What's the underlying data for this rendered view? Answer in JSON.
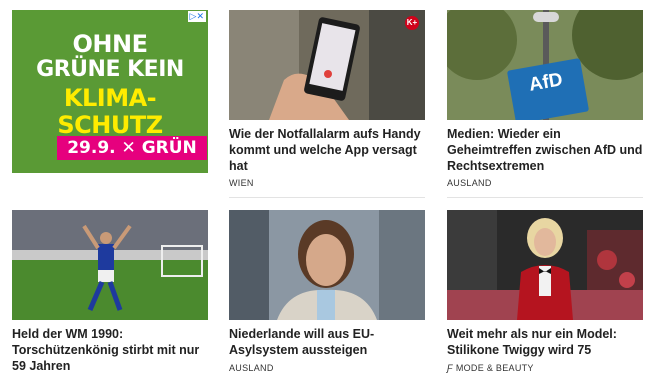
{
  "ad": {
    "lines": [
      "OHNE",
      "GRÜNE KEIN",
      "KLIMA-",
      "SCHUTZ"
    ],
    "badge": "29.9. ✕ GRÜN",
    "choice_label": "▷✕",
    "colors": {
      "bg": "#5a9a35",
      "white": "#ffffff",
      "yellow": "#ffec00",
      "magenta": "#e6007e"
    }
  },
  "articles": [
    {
      "title": "Wie der Notfallalarm aufs Handy kommt und welche App versagt hat",
      "category": "WIEN",
      "badge": "K+"
    },
    {
      "title": "Medien: Wieder ein Geheimtreffen zwischen AfD und Rechtsextremen",
      "category": "AUSLAND",
      "image_label": "AfD"
    },
    {
      "title": "Held der WM 1990: Torschützenkönig stirbt mit nur 59 Jahren",
      "category": ""
    },
    {
      "title": "Niederlande will aus EU-Asylsystem aussteigen",
      "category": "AUSLAND"
    },
    {
      "title": "Weit mehr als nur ein Model: Stilikone Twiggy wird 75",
      "category": "MODE & BEAUTY",
      "category_icon": "ƒ"
    }
  ]
}
